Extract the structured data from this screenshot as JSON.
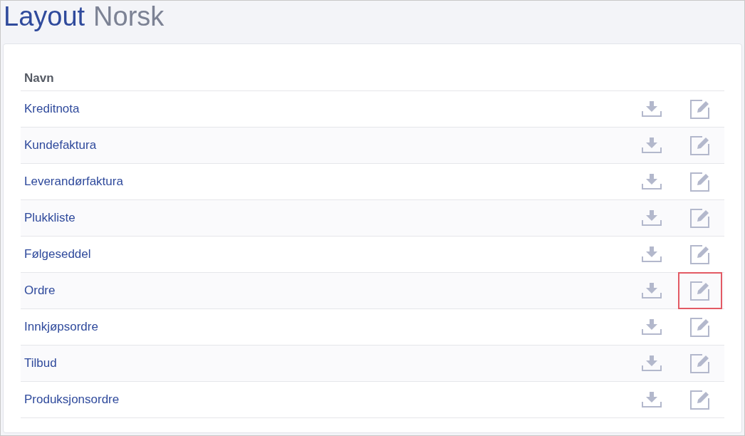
{
  "title": {
    "main": "Layout",
    "sub": "Norsk"
  },
  "table": {
    "columns": [
      "Navn"
    ],
    "rows": [
      {
        "name": "Kreditnota",
        "highlighted": false
      },
      {
        "name": "Kundefaktura",
        "highlighted": false
      },
      {
        "name": "Leverandørfaktura",
        "highlighted": false
      },
      {
        "name": "Plukkliste",
        "highlighted": false
      },
      {
        "name": "Følgeseddel",
        "highlighted": false
      },
      {
        "name": "Ordre",
        "highlighted": true
      },
      {
        "name": "Innkjøpsordre",
        "highlighted": false
      },
      {
        "name": "Tilbud",
        "highlighted": false
      },
      {
        "name": "Produksjonsordre",
        "highlighted": false
      }
    ]
  }
}
